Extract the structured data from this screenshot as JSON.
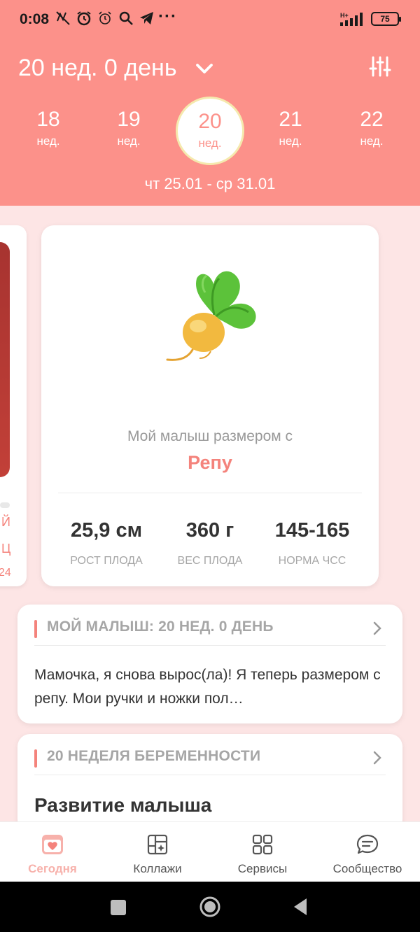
{
  "status_bar": {
    "time": "0:08",
    "network": "H+",
    "battery": "75",
    "more": "···"
  },
  "header": {
    "title": "20 нед. 0 день",
    "weeks": [
      {
        "num": "18",
        "unit": "нед."
      },
      {
        "num": "19",
        "unit": "нед."
      },
      {
        "num": "20",
        "unit": "нед."
      },
      {
        "num": "21",
        "unit": "нед."
      },
      {
        "num": "22",
        "unit": "нед."
      }
    ],
    "selected_week": "20",
    "date_range": "чт 25.01 - ср 31.01"
  },
  "left_card": {
    "line1": "Й",
    "line2": "Ц",
    "line3": "24"
  },
  "baby_card": {
    "caption": "Мой малыш размером с",
    "fruit_name": "Репу",
    "fruit_icon": "turnip-icon",
    "stats": [
      {
        "value": "25,9 см",
        "label": "РОСТ ПЛОДА"
      },
      {
        "value": "360 г",
        "label": "ВЕС ПЛОДА"
      },
      {
        "value": "145-165",
        "label": "НОРМА ЧСС"
      }
    ]
  },
  "article1": {
    "title": "МОЙ МАЛЫШ: 20 НЕД. 0 ДЕНЬ",
    "text": "Мамочка, я снова вырос(ла)! Я теперь размером с репу. Мои ручки и ножки пол…"
  },
  "article2": {
    "title": "20 НЕДЕЛЯ БЕРЕМЕННОСТИ",
    "heading": "Развитие малыша"
  },
  "bottom_nav": [
    {
      "label": "Сегодня",
      "icon": "calendar-heart-icon",
      "active": true
    },
    {
      "label": "Коллажи",
      "icon": "collage-icon",
      "active": false
    },
    {
      "label": "Сервисы",
      "icon": "grid-icon",
      "active": false
    },
    {
      "label": "Сообщество",
      "icon": "chat-icon",
      "active": false
    }
  ],
  "colors": {
    "header_bg": "#fc918a",
    "page_bg": "#fde5e5",
    "accent": "#f4837c",
    "selected_ring": "#f5e9ae"
  }
}
